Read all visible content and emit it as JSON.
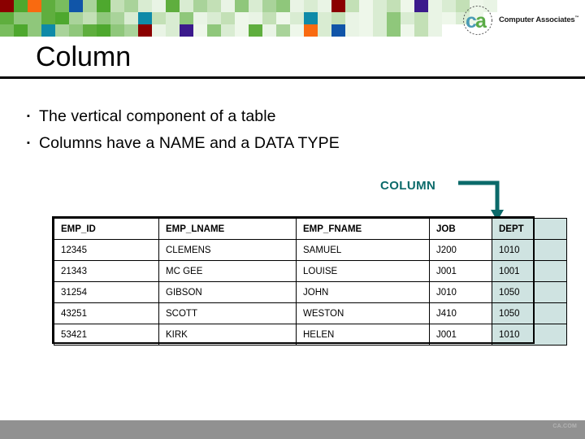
{
  "colors": {
    "teal_accent": "#0b6a6a",
    "dept_highlight": "#cfe3e1",
    "footer_bar": "#919191",
    "rule": "#000000",
    "logo_c": "#4a9bb5",
    "logo_a": "#5aab46"
  },
  "banner": {
    "name": "decorative-mosaic",
    "rows": [
      [
        "#8b0000",
        "#4ea82e",
        "#f96a10",
        "#5fae3e",
        "#79bd5e",
        "#1055a8",
        "#a9d39a",
        "#4ea82e",
        "#c3e0b6",
        "#a9d39a",
        "#d9ecd2",
        "#e9f4e5",
        "#5fae3e",
        "#d9ecd2",
        "#a9d39a",
        "#c3e0b6",
        "#e9f4e5",
        "#8fc77b",
        "#d9ecd2",
        "#a9d39a",
        "#8fc77b",
        "#e9f4e5",
        "#d9ecd2",
        "#e9f4e5",
        "#8b0000",
        "#c3e0b6",
        "#eef7ea",
        "#d9ecd2",
        "#c3e0b6",
        "#eef7ea",
        "#3b1a8c",
        "#e9f4e5",
        "#d9ecd2",
        "#c3e0b6",
        "#eef7ea",
        "#e9f4e5",
        "#ffffff",
        "#ffffff",
        "#ffffff",
        "#ffffff",
        "#ffffff",
        "#ffffff"
      ],
      [
        "#5fae3e",
        "#8fc77b",
        "#8fc77b",
        "#5fae3e",
        "#4ea82e",
        "#a9d39a",
        "#c3e0b6",
        "#8fc77b",
        "#a9d39a",
        "#d9ecd2",
        "#0e8aa8",
        "#c3e0b6",
        "#d9ecd2",
        "#8fc77b",
        "#e9f4e5",
        "#d9ecd2",
        "#c3e0b6",
        "#eef7ea",
        "#e9f4e5",
        "#c3e0b6",
        "#eef7ea",
        "#d9ecd2",
        "#0e8aa8",
        "#d9ecd2",
        "#c3e0b6",
        "#e9f4e5",
        "#eef7ea",
        "#d9ecd2",
        "#8fc77b",
        "#d9ecd2",
        "#c3e0b6",
        "#e9f4e5",
        "#eef7ea",
        "#d9ecd2",
        "#eef7ea",
        "#ffffff",
        "#ffffff",
        "#ffffff",
        "#ffffff",
        "#ffffff",
        "#ffffff",
        "#ffffff"
      ],
      [
        "#79bd5e",
        "#4ea82e",
        "#8fc77b",
        "#0e8aa8",
        "#a9d39a",
        "#8fc77b",
        "#5fae3e",
        "#4ea82e",
        "#8fc77b",
        "#a9d39a",
        "#8b0000",
        "#e9f4e5",
        "#d9ecd2",
        "#3b1a8c",
        "#eef7ea",
        "#8fc77b",
        "#d9ecd2",
        "#eef7ea",
        "#5fae3e",
        "#e9f4e5",
        "#a9d39a",
        "#eef7ea",
        "#f96a10",
        "#d9ecd2",
        "#1055a8",
        "#e9f4e5",
        "#eef7ea",
        "#d9ecd2",
        "#8fc77b",
        "#eef7ea",
        "#c3e0b6",
        "#e9f4e5",
        "#ffffff",
        "#ffffff",
        "#ffffff",
        "#ffffff",
        "#ffffff",
        "#ffffff",
        "#ffffff",
        "#ffffff",
        "#ffffff",
        "#ffffff"
      ]
    ]
  },
  "logo": {
    "name": "ca-computer-associates-logo",
    "mark_letters": "ca",
    "wordmark": "Computer Associates",
    "trademark": "™"
  },
  "slide": {
    "title": "Column"
  },
  "bullets": [
    {
      "marker": "▪",
      "text": "The vertical component of a table"
    },
    {
      "marker": "▪",
      "text": "Columns have a NAME and a DATA TYPE"
    }
  ],
  "callout": {
    "label": "COLUMN",
    "points_to": "DEPT"
  },
  "table": {
    "name": "employee-table",
    "columns": [
      "EMP_ID",
      "EMP_LNAME",
      "EMP_FNAME",
      "JOB",
      "DEPT"
    ],
    "highlight_column": "DEPT",
    "rows": [
      [
        "12345",
        "CLEMENS",
        "SAMUEL",
        "J200",
        "1010"
      ],
      [
        "21343",
        "MC GEE",
        "LOUISE",
        "J001",
        "1001"
      ],
      [
        "31254",
        "GIBSON",
        "JOHN",
        "J010",
        "1050"
      ],
      [
        "43251",
        "SCOTT",
        "WESTON",
        "J410",
        "1050"
      ],
      [
        "53421",
        "KIRK",
        "HELEN",
        "J001",
        "1010"
      ]
    ]
  },
  "footer": {
    "note": "CA.COM"
  }
}
